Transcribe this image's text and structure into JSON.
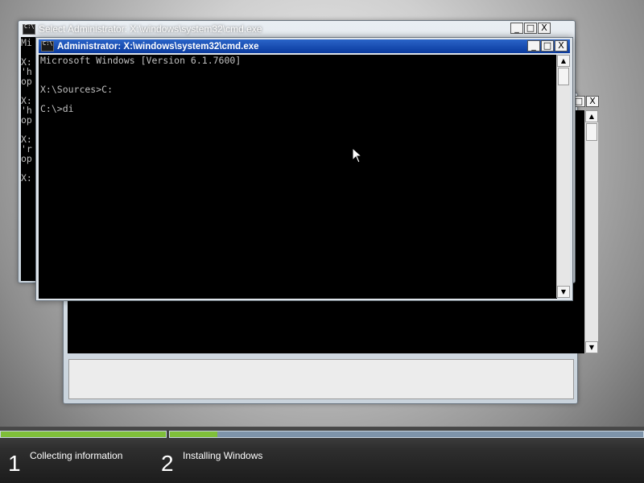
{
  "windows": {
    "background_cmd": {
      "title": "Select Administrator: X:\\windows\\system32\\cmd.exe",
      "visible_lines": [
        "Mi",
        "",
        "X:",
        "'h",
        "op",
        "",
        "X:",
        "'h",
        "op",
        "",
        "X:",
        "'r",
        "op",
        "",
        "X:"
      ]
    },
    "front_cmd": {
      "title": "Administrator: X:\\windows\\system32\\cmd.exe",
      "lines": [
        "Microsoft Windows [Version 6.1.7600]",
        "",
        "",
        "X:\\Sources>C:",
        "",
        "C:\\>di"
      ]
    }
  },
  "controls": {
    "minimize": "_",
    "maximize": "□",
    "close": "X"
  },
  "scroll": {
    "up": "▲",
    "down": "▼"
  },
  "setup": {
    "steps": [
      {
        "number": "1",
        "label": "Collecting information",
        "progress": 1.0
      },
      {
        "number": "2",
        "label": "Installing Windows",
        "progress": 0.1
      }
    ],
    "accent_fill": "#7fbf3a",
    "track_color": "#7e94aa"
  }
}
